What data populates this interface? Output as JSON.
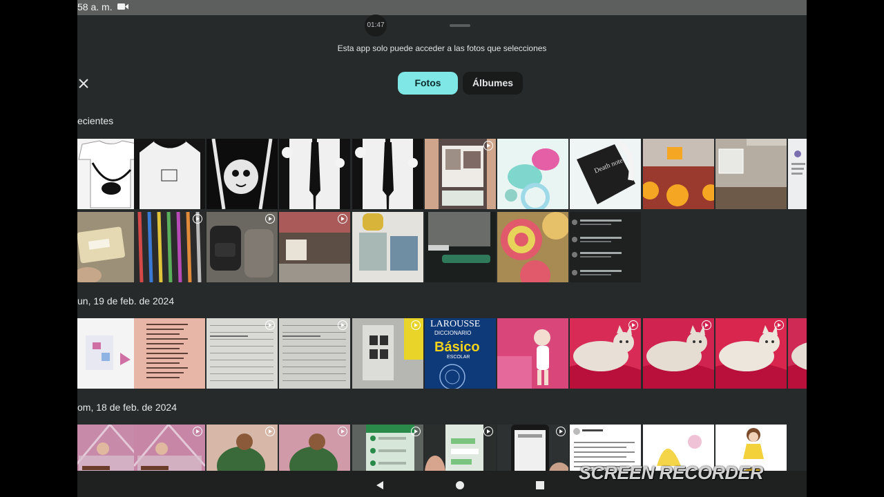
{
  "status_bar": {
    "time": "58 a. m.",
    "record_icon": "video-camera-icon"
  },
  "sheet": {
    "timer": "01:47",
    "access_note": "Esta app solo puede acceder a las fotos que selecciones"
  },
  "close_icon": "close-icon",
  "tabs": [
    {
      "label": "Fotos",
      "selected": true
    },
    {
      "label": "Álbumes",
      "selected": false
    }
  ],
  "sections": [
    {
      "title": "ecientes",
      "rows": [
        {
          "thumbs": [
            {
              "kind": "tshirt",
              "bg": "#f4f4f4",
              "accent": "#111111"
            },
            {
              "kind": "tshirt-dark",
              "bg": "#151515",
              "accent": "#f1f1f1"
            },
            {
              "kind": "cat-shirt",
              "bg": "#0d0d0d",
              "accent": "#e6e6e6"
            },
            {
              "kind": "suit",
              "bg": "#121212",
              "accent": "#f0f0f0"
            },
            {
              "kind": "suit",
              "bg": "#121212",
              "accent": "#f0f0f0"
            },
            {
              "kind": "screen",
              "bg": "#cfa58c",
              "accent": "#5a4a48",
              "video": true
            },
            {
              "kind": "shells",
              "bg": "#e9f5f3",
              "accent": "#e45fa6"
            },
            {
              "kind": "notebook",
              "bg": "#eef5f4",
              "accent": "#1e1e1e"
            },
            {
              "kind": "store",
              "bg": "#9a3a2e",
              "accent": "#f5a623"
            },
            {
              "kind": "room",
              "bg": "#b5aca2",
              "accent": "#6e5a48"
            },
            {
              "kind": "doc",
              "bg": "#eceef0",
              "accent": "#7c6fb0"
            }
          ]
        },
        {
          "thumbs": [
            {
              "kind": "card",
              "bg": "#9c9078",
              "accent": "#e4d9b2",
              "video": true
            },
            {
              "kind": "umbrellas",
              "bg": "#2b2b2b",
              "accent": "#d44848",
              "video": true
            },
            {
              "kind": "bags",
              "bg": "#6b6862",
              "accent": "#232323",
              "video": true
            },
            {
              "kind": "street",
              "bg": "#a95a59",
              "accent": "#e9e2d6",
              "video": true
            },
            {
              "kind": "shop",
              "bg": "#e3e2dc",
              "accent": "#d9b43a"
            },
            {
              "kind": "chat",
              "bg": "#1b201e",
              "accent": "#2f7a5a"
            },
            {
              "kind": "shells2",
              "bg": "#a88b52",
              "accent": "#e05a6b"
            },
            {
              "kind": "comments",
              "bg": "#1f2121",
              "accent": "#a4a9a9"
            }
          ]
        }
      ]
    },
    {
      "title": "un, 19 de feb. de 2024",
      "rows": [
        {
          "thumbs": [
            {
              "kind": "products",
              "bg": "#f4f4f4",
              "accent": "#cf6fa4"
            },
            {
              "kind": "letter",
              "bg": "#e8b6a6",
              "accent": "#5e3f37"
            },
            {
              "kind": "paper",
              "bg": "#d9d9d6",
              "accent": "#9a9a96",
              "video": true
            },
            {
              "kind": "paper",
              "bg": "#cfcfcb",
              "accent": "#8f8f8b",
              "video": true
            },
            {
              "kind": "book-open",
              "bg": "#b6b6b3",
              "accent": "#2f2f2f",
              "video": true
            },
            {
              "kind": "dictionary",
              "bg": "#0f3a7a",
              "accent": "#f2d21a",
              "text": {
                "brand": "LAROUSSE",
                "line": "DICCIONARIO",
                "big": "Básico",
                "small": "ESCOLAR"
              }
            },
            {
              "kind": "girl",
              "bg": "#d8467a",
              "accent": "#f2ddd0"
            },
            {
              "kind": "cat",
              "bg": "#d82c56",
              "accent": "#e8e0d6",
              "video": true
            },
            {
              "kind": "cat",
              "bg": "#d0234f",
              "accent": "#e5ddd2",
              "video": true
            },
            {
              "kind": "cat",
              "bg": "#d8264f",
              "accent": "#ece6dd",
              "video": true
            },
            {
              "kind": "cat",
              "bg": "#cf2a55",
              "accent": "#e6ded4"
            }
          ]
        }
      ]
    },
    {
      "title": "om, 18 de feb. de 2024",
      "rows": [
        {
          "thumbs": [
            {
              "kind": "crib",
              "bg": "#c78ba9",
              "accent": "#6a3c2c"
            },
            {
              "kind": "crib",
              "bg": "#c786a6",
              "accent": "#6a3c2c",
              "video": true
            },
            {
              "kind": "sleep",
              "bg": "#d7b8a8",
              "accent": "#3a6a3a",
              "video": true
            },
            {
              "kind": "sleep",
              "bg": "#d09aa8",
              "accent": "#3a6a3a",
              "video": true
            },
            {
              "kind": "phone-list",
              "bg": "#d6e6d8",
              "accent": "#2a8a4a",
              "video": true
            },
            {
              "kind": "phone-chat",
              "bg": "#2a2e2d",
              "accent": "#dfe9df",
              "video": true
            },
            {
              "kind": "phone-hand",
              "bg": "#2e3131",
              "accent": "#f0f0f0",
              "video": true
            },
            {
              "kind": "post",
              "bg": "#ffffff",
              "accent": "#8a8a8a"
            },
            {
              "kind": "princess-sheet",
              "bg": "#ffffff",
              "accent": "#f4d54a"
            },
            {
              "kind": "princess",
              "bg": "#ffffff",
              "accent": "#f2d13a"
            }
          ]
        }
      ]
    }
  ],
  "nav": {
    "back_icon": "back-triangle-icon",
    "home_icon": "home-circle-icon",
    "recents_icon": "recents-square-icon"
  },
  "watermark": "SCREEN RECORDER"
}
